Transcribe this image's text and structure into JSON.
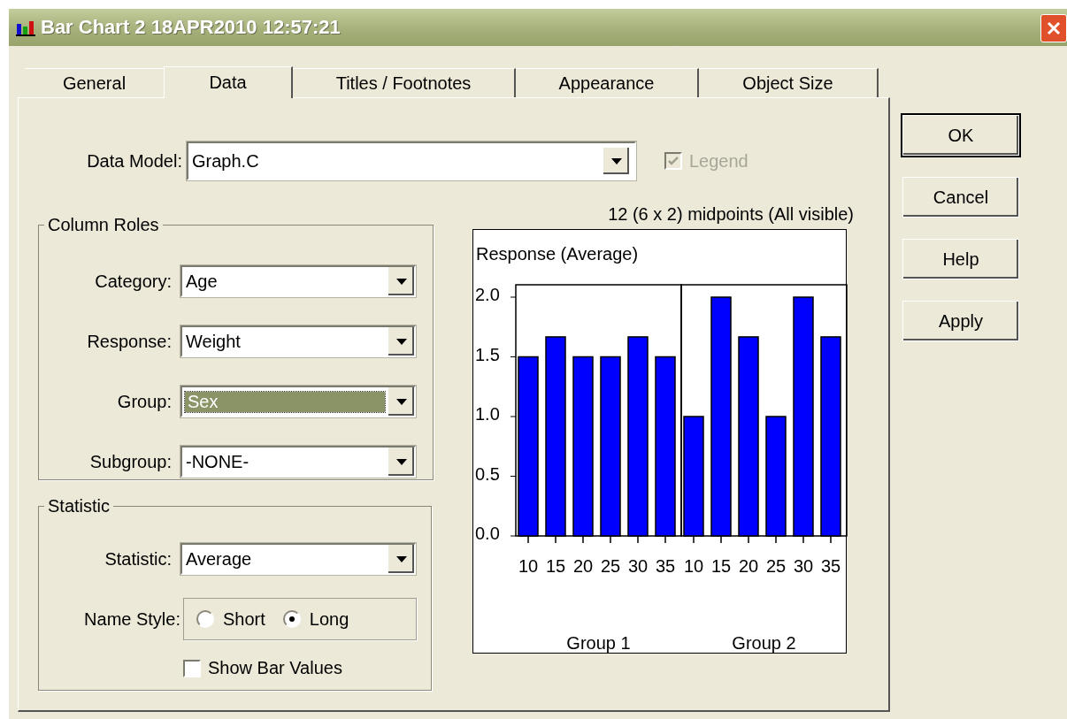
{
  "window": {
    "title": "Bar Chart 2 18APR2010 12:57:21"
  },
  "tabs": [
    {
      "label": "General",
      "selected": false
    },
    {
      "label": "Data",
      "selected": true
    },
    {
      "label": "Titles / Footnotes",
      "selected": false
    },
    {
      "label": "Appearance",
      "selected": false
    },
    {
      "label": "Object Size",
      "selected": false
    }
  ],
  "data_model": {
    "label": "Data Model:",
    "value": "Graph.C"
  },
  "legend": {
    "label": "Legend",
    "checked": true,
    "disabled": true
  },
  "column_roles": {
    "title": "Column Roles",
    "fields": [
      {
        "label": "Category:",
        "value": "Age",
        "focused": false
      },
      {
        "label": "Response:",
        "value": "Weight",
        "focused": false
      },
      {
        "label": "Group:",
        "value": "Sex",
        "focused": true
      },
      {
        "label": "Subgroup:",
        "value": "-NONE-",
        "focused": false
      }
    ]
  },
  "statistic": {
    "title": "Statistic",
    "field": {
      "label": "Statistic:",
      "value": "Average"
    },
    "name_style": {
      "label": "Name Style:",
      "options": [
        {
          "label": "Short",
          "selected": false
        },
        {
          "label": "Long",
          "selected": true
        }
      ]
    },
    "show_bar_values": {
      "label": "Show Bar Values",
      "checked": false
    }
  },
  "preview": {
    "caption": "12 (6 x 2) midpoints (All visible)",
    "chart_data": {
      "type": "bar",
      "title": "Response (Average)",
      "categories": [
        "10",
        "15",
        "20",
        "25",
        "30",
        "35",
        "10",
        "15",
        "20",
        "25",
        "30",
        "35"
      ],
      "values": [
        1.5,
        1.667,
        1.5,
        1.5,
        1.667,
        1.5,
        1.0,
        2.0,
        1.667,
        1.0,
        2.0,
        1.667
      ],
      "ylim": [
        0,
        2
      ],
      "yticks": [
        {
          "value": 0,
          "label": "0.0"
        },
        {
          "value": 0.5,
          "label": "0.5"
        },
        {
          "value": 1,
          "label": "1.0"
        },
        {
          "value": 1.5,
          "label": "1.5"
        },
        {
          "value": 2,
          "label": "2.0"
        }
      ],
      "annotations": [
        "Group 1",
        "Group 2"
      ]
    }
  },
  "buttons": [
    {
      "label": "OK",
      "default": true
    },
    {
      "label": "Cancel",
      "default": false
    },
    {
      "label": "Help",
      "default": false
    },
    {
      "label": "Apply",
      "default": false
    }
  ]
}
